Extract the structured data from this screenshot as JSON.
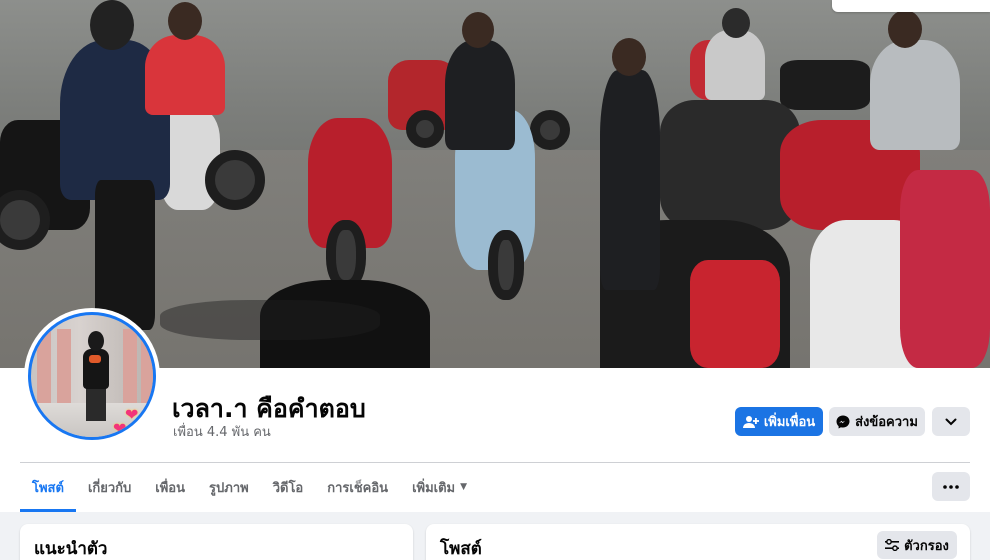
{
  "profile": {
    "name": "เวลา.า คือคำตอบ",
    "friends": "เพื่อน 4.4 พัน คน"
  },
  "actions": {
    "add_friend": "เพิ่มเพื่อน",
    "message": "ส่งข้อความ"
  },
  "tabs": [
    {
      "label": "โพสต์",
      "active": true
    },
    {
      "label": "เกี่ยวกับ",
      "active": false
    },
    {
      "label": "เพื่อน",
      "active": false
    },
    {
      "label": "รูปภาพ",
      "active": false
    },
    {
      "label": "วิดีโอ",
      "active": false
    },
    {
      "label": "การเช็คอิน",
      "active": false
    },
    {
      "label": "เพิ่มเติม",
      "active": false
    }
  ],
  "cards": {
    "intro_title": "แนะนำตัว",
    "posts_title": "โพสต์",
    "filter_label": "ตัวกรอง"
  },
  "colors": {
    "accent": "#1877f2",
    "secondary_button": "#e4e6eb",
    "background": "#f0f2f5"
  },
  "icons": [
    "add-friend-icon",
    "messenger-icon",
    "chevron-down-icon",
    "more-dots-icon",
    "filter-icon",
    "caret-down-icon"
  ]
}
